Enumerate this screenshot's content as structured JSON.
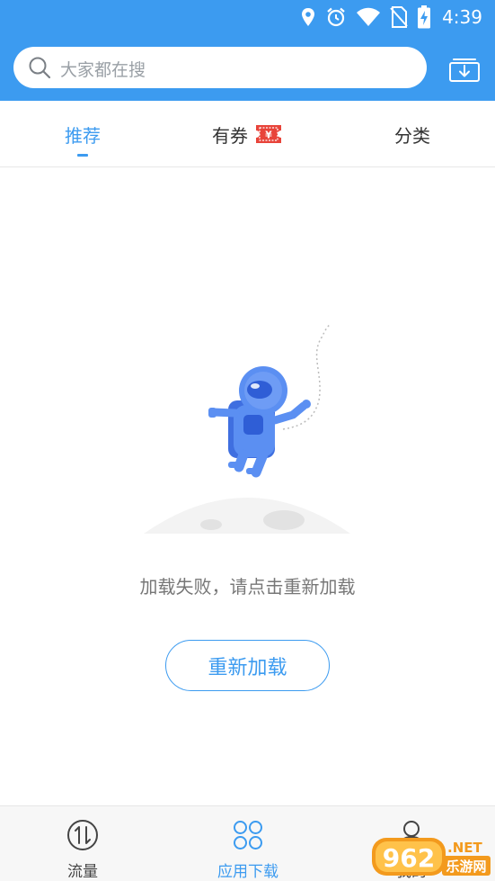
{
  "status_bar": {
    "time": "4:39",
    "icons": [
      "location-icon",
      "alarm-icon",
      "wifi-icon",
      "no-sim-icon",
      "battery-charging-icon"
    ]
  },
  "search": {
    "placeholder": "大家都在搜",
    "download_icon": "download-manager-icon"
  },
  "tabs": [
    {
      "label": "推荐",
      "active": true
    },
    {
      "label": "有券",
      "active": false,
      "badge_icon": "coupon-icon",
      "badge_text": "¥"
    },
    {
      "label": "分类",
      "active": false
    }
  ],
  "empty_state": {
    "illustration": "astronaut-on-moon-illustration",
    "message": "加载失败，请点击重新加载",
    "reload_label": "重新加载"
  },
  "bottom_nav": [
    {
      "label": "流量",
      "icon": "traffic-icon",
      "active": false
    },
    {
      "label": "应用下载",
      "icon": "app-download-icon",
      "active": true
    },
    {
      "label": "我的",
      "icon": "profile-icon",
      "active": false
    }
  ],
  "watermark": {
    "logo": "962",
    "suffix": ".NET",
    "text": "乐游网"
  },
  "colors": {
    "accent": "#3c9bf0",
    "coupon_red": "#e8443a",
    "astronaut_blue": "#5b8ff2"
  }
}
